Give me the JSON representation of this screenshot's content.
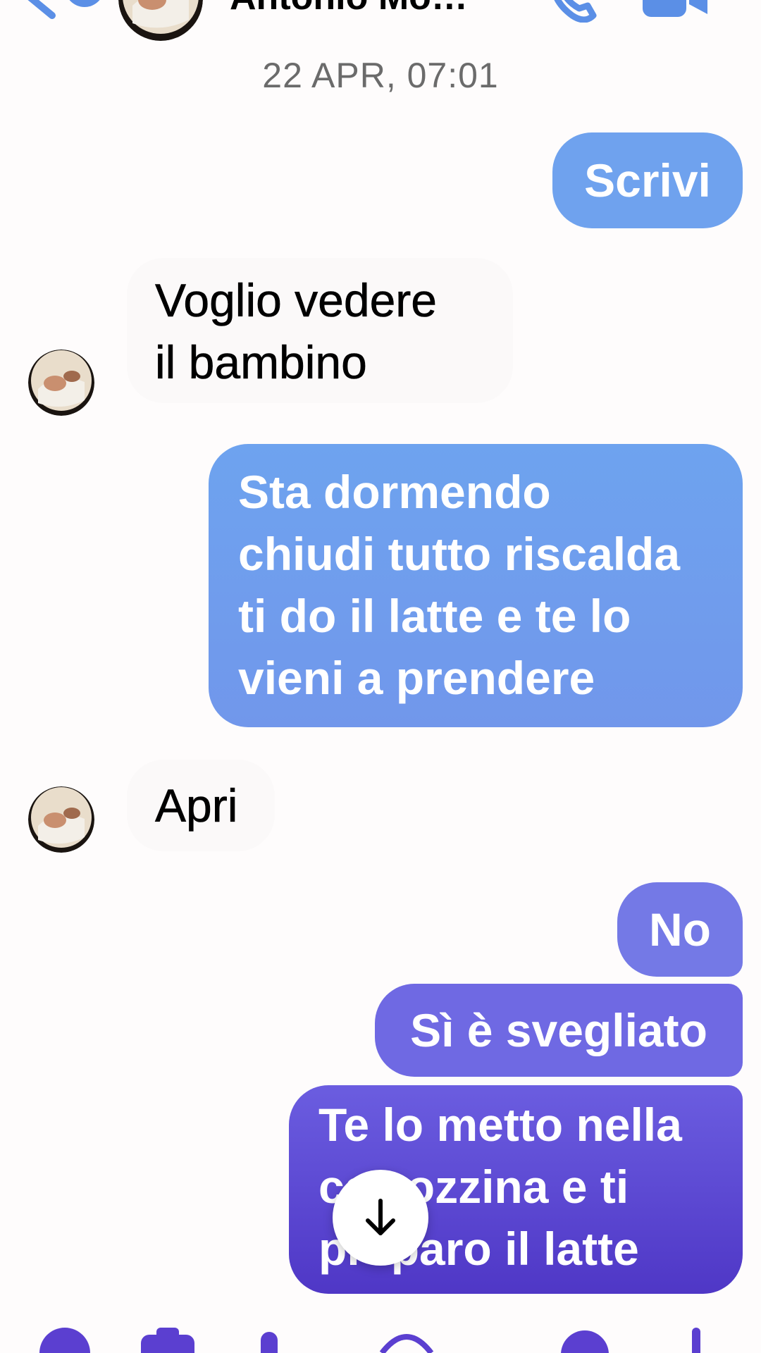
{
  "header": {
    "contact_name": "Antonio Mo…"
  },
  "timestamp": "22 APR, 07:01",
  "messages": [
    {
      "direction": "outgoing",
      "text": "Scrivi"
    },
    {
      "direction": "incoming",
      "lines": [
        "Voglio vedere",
        "il bambino"
      ]
    },
    {
      "direction": "outgoing",
      "lines": [
        "Sta dormendo",
        "chiudi tutto riscalda",
        "ti do il latte e te lo",
        "vieni a prendere"
      ]
    },
    {
      "direction": "incoming",
      "text": "Apri"
    },
    {
      "direction": "outgoing",
      "text": "No"
    },
    {
      "direction": "outgoing",
      "text": "Sì è svegliato"
    },
    {
      "direction": "outgoing",
      "lines": [
        "Te lo metto nella",
        "carrozzina e ti",
        "preparo il latte"
      ]
    }
  ],
  "colors": {
    "accent": "#6fa2ee",
    "accent_purple": "#5b45d2",
    "background": "#fefcfc",
    "timestamp_text": "#6b6b6b"
  },
  "icons": {
    "back": "chevron-left-icon",
    "call": "phone-icon",
    "video": "video-camera-icon",
    "scroll_down": "arrow-down-icon",
    "composer": [
      "plus-circle-icon",
      "camera-icon",
      "gallery-icon",
      "mic-icon",
      "emoji-icon",
      "thumbs-up-icon"
    ]
  }
}
